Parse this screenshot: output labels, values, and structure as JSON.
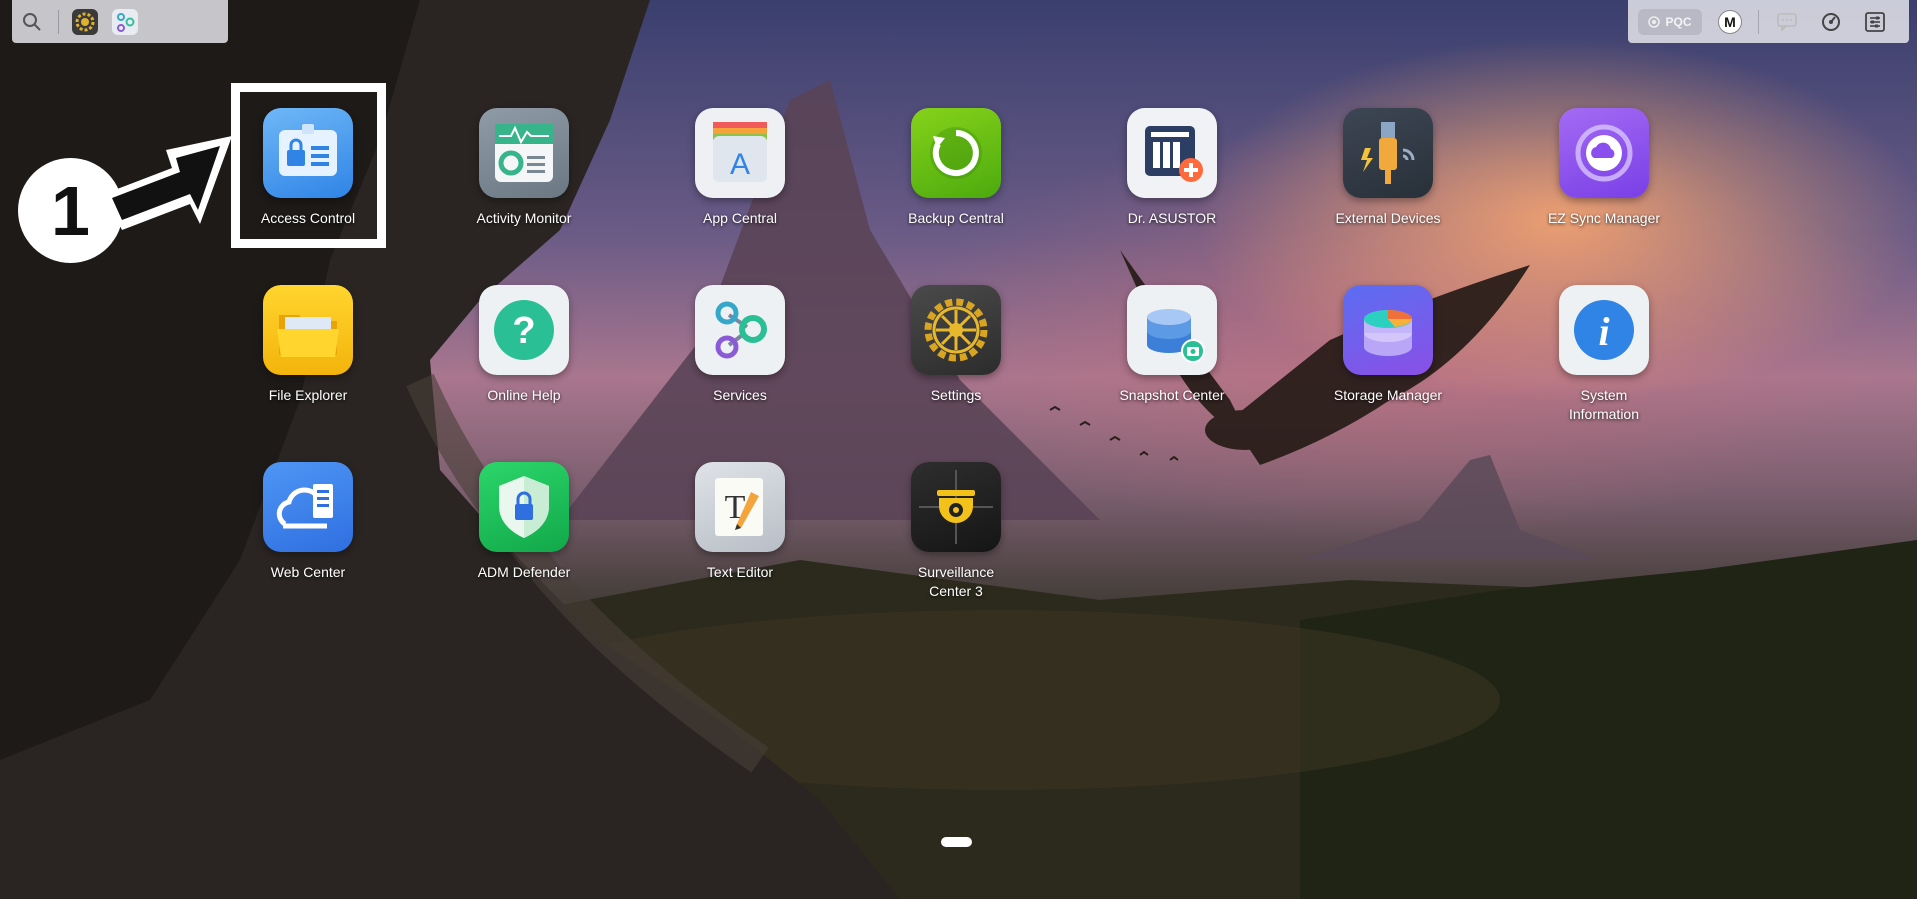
{
  "topbar_left": {
    "icons": [
      "search-icon",
      "settings-app-icon",
      "services-app-icon"
    ]
  },
  "topbar_right": {
    "pqc_label": "PQC",
    "user_initial": "M",
    "icons": [
      "message-icon",
      "dashboard-icon",
      "menu-settings-icon"
    ]
  },
  "callout": {
    "number": "1"
  },
  "apps": [
    {
      "label": "Access Control",
      "icon": "access-control-icon"
    },
    {
      "label": "Activity Monitor",
      "icon": "activity-monitor-icon"
    },
    {
      "label": "App Central",
      "icon": "app-central-icon"
    },
    {
      "label": "Backup Central",
      "icon": "backup-central-icon"
    },
    {
      "label": "Dr. ASUSTOR",
      "icon": "dr-asustor-icon"
    },
    {
      "label": "External Devices",
      "icon": "external-devices-icon"
    },
    {
      "label": "EZ Sync Manager",
      "icon": "ez-sync-manager-icon"
    },
    {
      "label": "File Explorer",
      "icon": "file-explorer-icon"
    },
    {
      "label": "Online Help",
      "icon": "online-help-icon"
    },
    {
      "label": "Services",
      "icon": "services-icon"
    },
    {
      "label": "Settings",
      "icon": "settings-icon"
    },
    {
      "label": "Snapshot Center",
      "icon": "snapshot-center-icon"
    },
    {
      "label": "Storage Manager",
      "icon": "storage-manager-icon"
    },
    {
      "label": "System Information",
      "icon": "system-information-icon"
    },
    {
      "label": "Web Center",
      "icon": "web-center-icon"
    },
    {
      "label": "ADM Defender",
      "icon": "adm-defender-icon"
    },
    {
      "label": "Text Editor",
      "icon": "text-editor-icon"
    },
    {
      "label": "Surveillance Center 3",
      "icon": "surveillance-center-icon"
    }
  ]
}
